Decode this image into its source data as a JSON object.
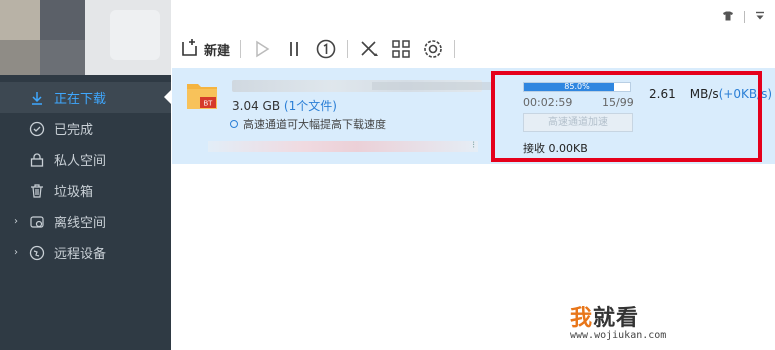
{
  "window": {
    "controls": [
      "shirt-icon",
      "menu-icon"
    ]
  },
  "toolbar": {
    "new_label": "新建",
    "buttons": [
      "start-icon",
      "pause-icon",
      "limit-speed-icon",
      "delete-icon",
      "grid-icon",
      "settings-icon"
    ]
  },
  "sidebar": {
    "items": [
      {
        "label": "正在下载",
        "icon": "download-icon",
        "active": true
      },
      {
        "label": "已完成",
        "icon": "check-circle-icon"
      },
      {
        "label": "私人空间",
        "icon": "lock-icon"
      },
      {
        "label": "垃圾箱",
        "icon": "trash-icon"
      },
      {
        "label": "离线空间",
        "icon": "cloud-icon",
        "expandable": true
      },
      {
        "label": "远程设备",
        "icon": "globe-icon",
        "expandable": true
      }
    ]
  },
  "download": {
    "badge": "BT",
    "size": "3.04 GB",
    "file_count": "(1个文件)",
    "hint": "高速通道可大幅提高下载速度",
    "progress_text": "85.0%",
    "progress": 0.85,
    "elapsed": "00:02:59",
    "pieces": "15/99",
    "accel_button": "高速通道加速",
    "received": "接收 0.00KB",
    "speed_value": "2.61",
    "speed_unit": "MB/s",
    "speed_extra": "(+0KB/s)"
  },
  "watermark": {
    "char1": "我",
    "rest": "就看",
    "url": "www.wojiukan.com"
  },
  "colors": {
    "accent": "#2f86e0",
    "highlight_box": "#e5001b",
    "sidebar_bg": "#2f3a44",
    "row_bg": "#d9ecfc"
  }
}
